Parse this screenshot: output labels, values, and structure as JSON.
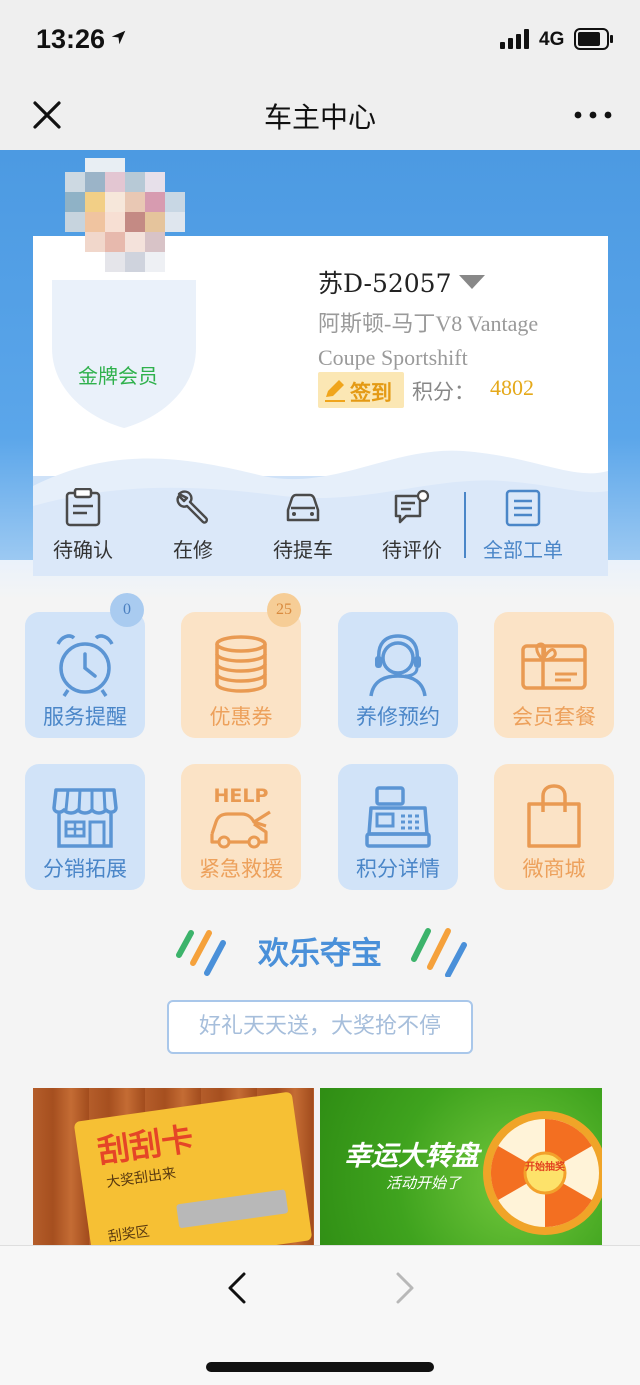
{
  "status_bar": {
    "time": "13:26",
    "network": "4G"
  },
  "nav": {
    "title": "车主中心"
  },
  "profile": {
    "member_level": "金牌会员",
    "plate": "苏D-52057",
    "car_model": "阿斯顿-马丁V8 Vantage Coupe Sportshift",
    "signin_label": "签到",
    "points_label": "积分：",
    "points_value": "4802"
  },
  "order_tabs": [
    {
      "label": "待确认"
    },
    {
      "label": "在修"
    },
    {
      "label": "待提车"
    },
    {
      "label": "待评价"
    },
    {
      "label": "全部工单"
    }
  ],
  "grid": [
    {
      "label": "服务提醒",
      "badge": "0"
    },
    {
      "label": "优惠券",
      "badge": "25"
    },
    {
      "label": "养修预约"
    },
    {
      "label": "会员套餐"
    },
    {
      "label": "分销拓展"
    },
    {
      "label": "紧急救援",
      "icon_text": "HELP"
    },
    {
      "label": "积分详情"
    },
    {
      "label": "微商城"
    }
  ],
  "treasure": {
    "title": "欢乐夺宝",
    "subtitle": "好礼天天送，大奖抢不停"
  },
  "banners": {
    "scratch": {
      "title": "刮刮卡",
      "subtitle": "大奖刮出来",
      "zone_label": "刮奖区"
    },
    "wheel": {
      "title": "幸运大转盘",
      "subtitle": "活动开始了",
      "center": "开始抽奖"
    }
  },
  "colors": {
    "header_blue": "#4c9ae2",
    "tile_blue": "#d1e3f8",
    "tile_orange": "#fbe3c6",
    "accent_blue": "#4a86c8",
    "accent_orange": "#eda15c",
    "points_gold": "#e5a91a",
    "member_green": "#2fb14c"
  },
  "icons": {
    "status": [
      "location-arrow-icon",
      "signal-icon",
      "battery-icon"
    ],
    "nav": [
      "close-icon",
      "more-icon"
    ],
    "tabs": [
      "clipboard-icon",
      "wrench-icon",
      "car-icon",
      "comment-icon",
      "list-icon"
    ],
    "grid": [
      "alarm-clock-icon",
      "coins-icon",
      "headset-agent-icon",
      "gift-card-icon",
      "store-icon",
      "help-car-icon",
      "cash-register-icon",
      "shopping-bag-icon"
    ]
  }
}
